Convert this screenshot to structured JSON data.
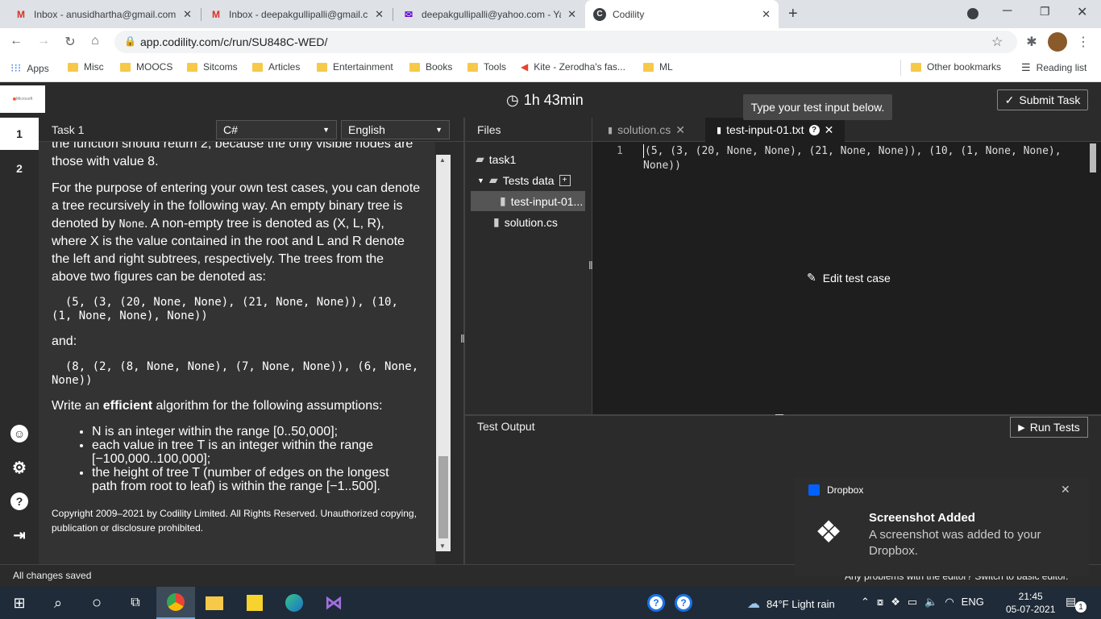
{
  "browser": {
    "tabs": [
      {
        "title": "Inbox - anusidhartha@gmail.com",
        "icon": "gmail-icon"
      },
      {
        "title": "Inbox - deepakgullipalli@gmail.c",
        "icon": "gmail-icon"
      },
      {
        "title": "deepakgullipalli@yahoo.com - Ya",
        "icon": "yahoo-mail-icon"
      },
      {
        "title": "Codility",
        "icon": "codility-icon"
      }
    ],
    "url": "app.codility.com/c/run/SU848C-WED/",
    "bookmarks": [
      "Apps",
      "Misc",
      "MOOCS",
      "Sitcoms",
      "Articles",
      "Entertainment",
      "Books",
      "Tools",
      "Kite - Zerodha's fas...",
      "ML"
    ],
    "other_bookmarks": "Other bookmarks",
    "reading_list": "Reading list"
  },
  "header": {
    "logo": "Microsoft",
    "timer": "1h 43min",
    "submit_label": "Submit Task",
    "tooltip": "Type your test input below."
  },
  "sidebar": {
    "tasks": [
      "1",
      "2"
    ]
  },
  "task": {
    "title": "Task 1",
    "language": "C#",
    "human_language": "English",
    "cutoff_line": "the function should return 2, because the only visible nodes are",
    "p1_end": "those with value 8.",
    "p2_a": "For the purpose of entering your own test cases, you can denote a tree recursively in the following way. An empty binary tree is denoted by ",
    "p2_none": "None",
    "p2_b": ". A non-empty tree is denoted as (X, L, R), where X is the value contained in the root and L and R denote the left and right subtrees, respectively. The trees from the above two figures can be denoted as:",
    "tree1": "  (5, (3, (20, None, None), (21, None, None)), (10, (1, None, None), None))",
    "and": "and:",
    "tree2": "  (8, (2, (8, None, None), (7, None, None)), (6, None, None))",
    "write_a": "Write an ",
    "write_bold": "efficient",
    "write_b": " algorithm for the following assumptions:",
    "bullets": [
      "N is an integer within the range [0..50,000];",
      "each value in tree T is an integer within the range [−100,000..100,000];",
      "the height of tree T (number of edges on the longest path from root to leaf) is within the range [−1..500]."
    ],
    "copyright": "Copyright 2009–2021 by Codility Limited. All Rights Reserved. Unauthorized copying, publication or disclosure prohibited."
  },
  "files": {
    "header": "Files",
    "root": "task1",
    "tests_folder": "Tests data",
    "test_file": "test-input-01...",
    "solution": "solution.cs"
  },
  "editor": {
    "tabs": [
      "solution.cs",
      "test-input-01.txt"
    ],
    "line_number": "1",
    "code": "(5, (3, (20, None, None), (21, None, None)), (10, (1, None, None),",
    "code_cont": "None))",
    "edit_test_case": "Edit test case"
  },
  "test_output": {
    "title": "Test Output",
    "run_label": "Run Tests"
  },
  "status": {
    "saved": "All changes saved",
    "problems_cut": "Any problems with the editor? Switch to basic editor."
  },
  "toast": {
    "app": "Dropbox",
    "title": "Screenshot Added",
    "body": "A screenshot was added to your Dropbox."
  },
  "taskbar": {
    "weather": "84°F  Light rain",
    "lang": "ENG",
    "time": "21:45",
    "date": "05-07-2021",
    "notifications": "1"
  }
}
